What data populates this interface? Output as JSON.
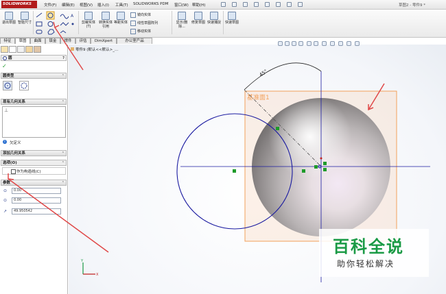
{
  "app": {
    "logo_text": "SOLIDWORKS",
    "doc_title": "草图2 - 零件9 *"
  },
  "menu": [
    "文件(F)",
    "编辑(E)",
    "视图(V)",
    "插入(I)",
    "工具(T)",
    "SOLIDWORKS PDM",
    "窗口(W)",
    "帮助(H)"
  ],
  "ribbon": {
    "exit_sketch": "退出草图",
    "smart_dim": "智能尺寸",
    "trim": "剪裁实体(T)",
    "convert": "转换实体引用",
    "offset": "等距实体",
    "mirror": "镜向实体",
    "linear_pattern": "线性草图阵列",
    "move": "移动实体",
    "display_delete": "显示/删除...",
    "repair": "修复草图",
    "quick_snap": "快速捕捉",
    "rapid_sketch": "快速草图"
  },
  "tabs": [
    "特征",
    "草图",
    "曲面",
    "钣金",
    "焊件",
    "评估",
    "DimXpert",
    "办公室产品"
  ],
  "tree_item": "零件9 (默认<<默认>_...",
  "panel": {
    "title": "圆",
    "circle_type": "圆类型",
    "existing_relations": "现有几何关系",
    "under_defined": "欠定义",
    "add_relations": "添加几何关系",
    "options": "选项(O)",
    "construction_label": "作为构造线(C)",
    "parameters": "参数",
    "param_x": "0.00",
    "param_y": "0.00",
    "param_r": "49.950542"
  },
  "canvas": {
    "plane_label": "基准面1",
    "angle_label": "45°"
  },
  "watermark": {
    "title": "百科全说",
    "subtitle": "助你轻松解决"
  },
  "colors": {
    "accent_red": "#b11a1a",
    "sketch_blue": "#1a1aa0",
    "plane_orange": "#f2a05a",
    "watermark_green": "#1a9a45"
  }
}
